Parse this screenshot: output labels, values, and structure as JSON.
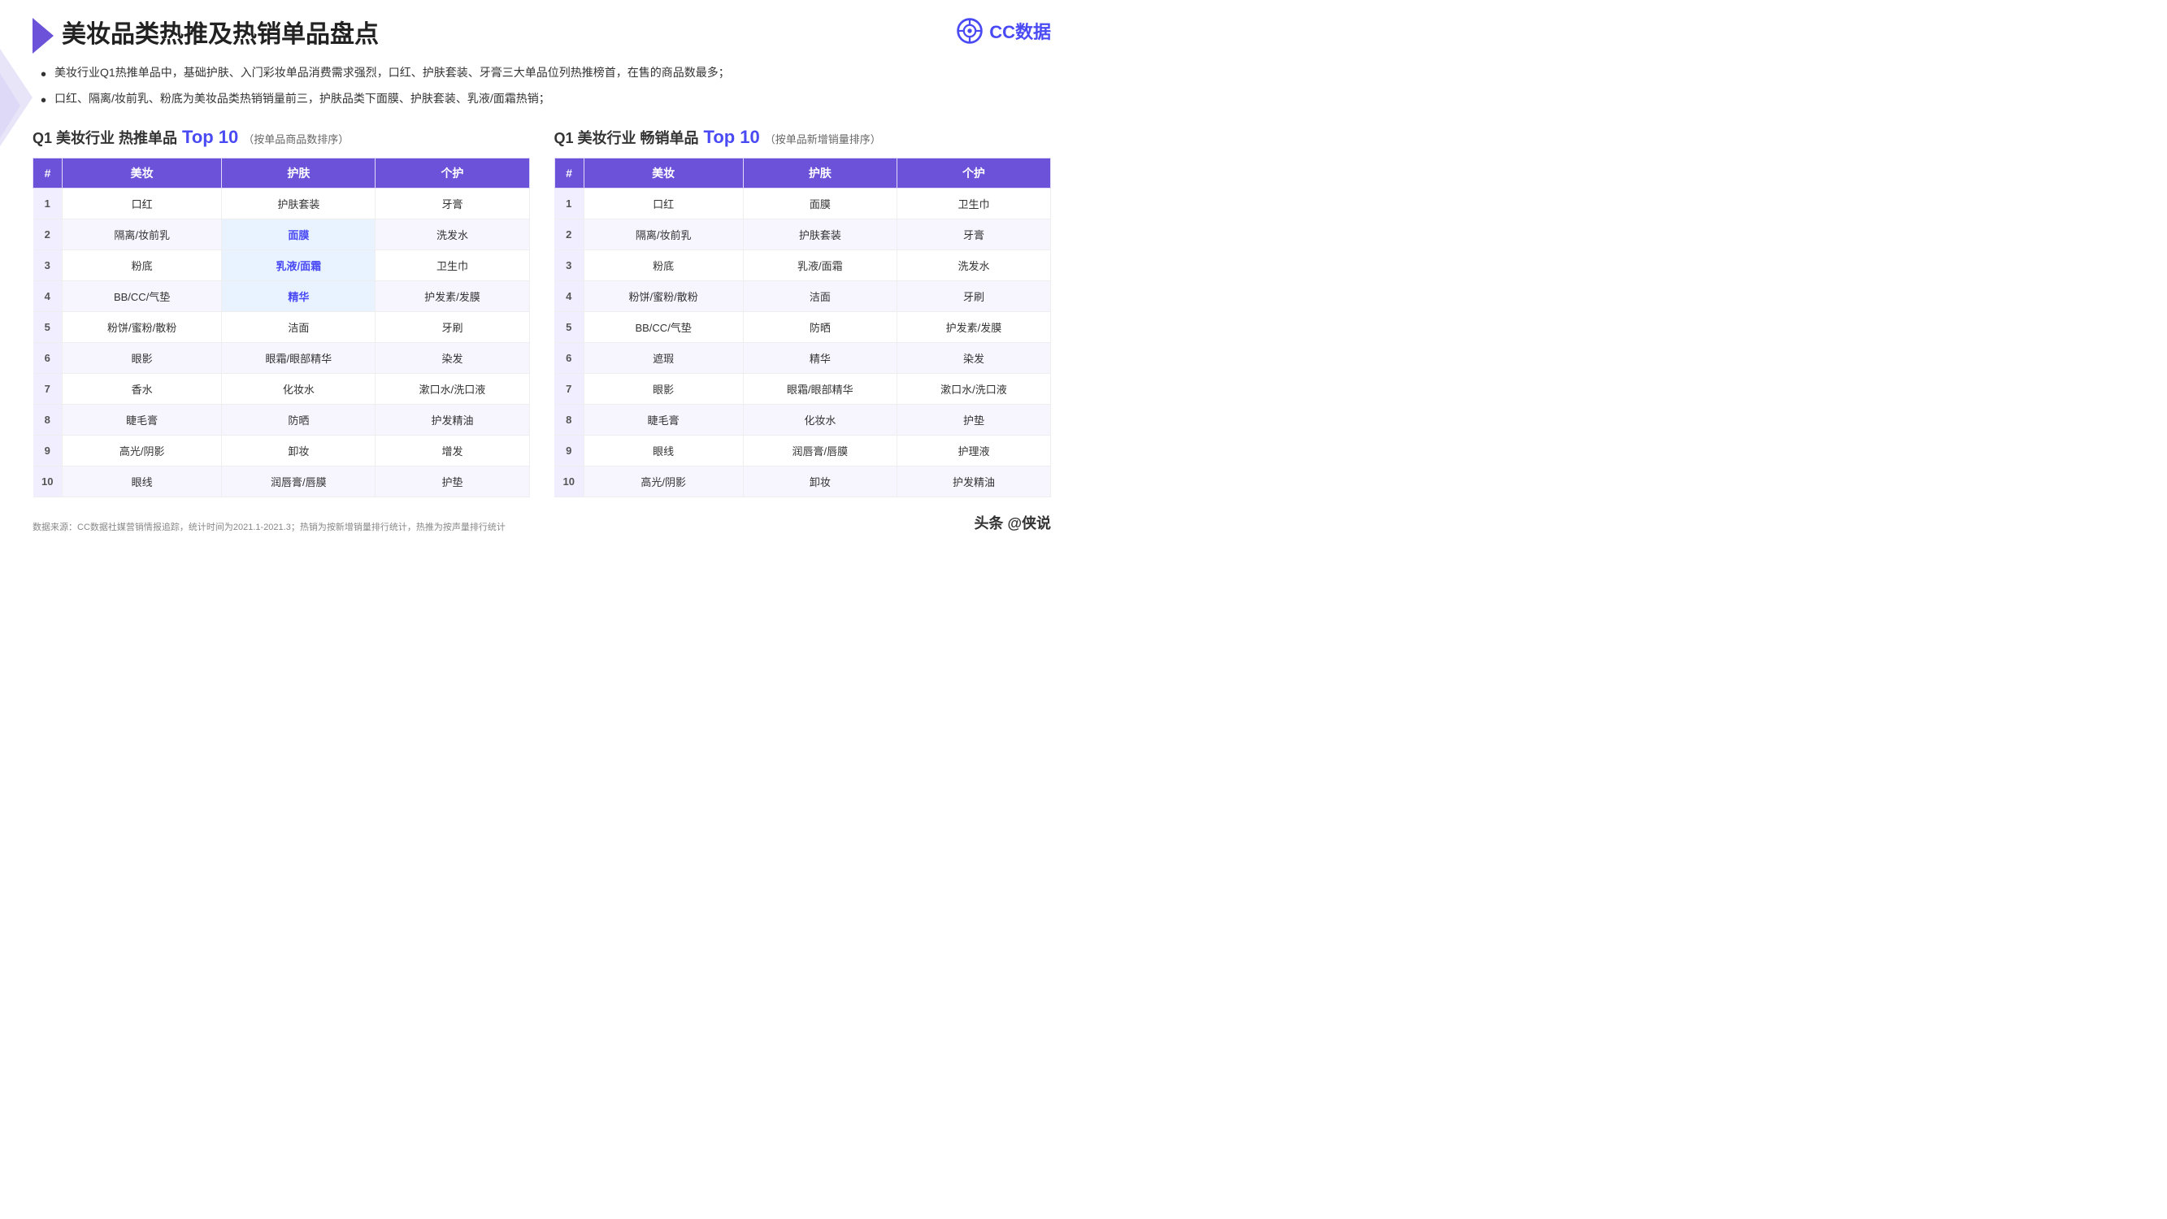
{
  "logo": {
    "text": "CC数据",
    "icon_label": "cc-logo-icon"
  },
  "page_title": "美妆品类热推及热销单品盘点",
  "bullets": [
    "美妆行业Q1热推单品中，基础护肤、入门彩妆单品消费需求强烈，口红、护肤套装、牙膏三大单品位列热推榜首，在售的商品数最多；",
    "口红、隔离/妆前乳、粉底为美妆品类热销销量前三，护肤品类下面膜、护肤套装、乳液/面霜热销；"
  ],
  "table1": {
    "title_prefix": "Q1 美妆行业 热推单品",
    "title_highlight": "Top",
    "title_number": "10",
    "title_suffix": "（按单品商品数排序）",
    "headers": [
      "#",
      "美妆",
      "护肤",
      "个护"
    ],
    "rows": [
      {
        "rank": "1",
        "col1": "口红",
        "col2": "护肤套装",
        "col3": "牙膏",
        "highlight": []
      },
      {
        "rank": "2",
        "col1": "隔离/妆前乳",
        "col2": "面膜",
        "col3": "洗发水",
        "highlight": [
          "col2"
        ]
      },
      {
        "rank": "3",
        "col1": "粉底",
        "col2": "乳液/面霜",
        "col3": "卫生巾",
        "highlight": [
          "col2"
        ]
      },
      {
        "rank": "4",
        "col1": "BB/CC/气垫",
        "col2": "精华",
        "col3": "护发素/发膜",
        "highlight": [
          "col2"
        ]
      },
      {
        "rank": "5",
        "col1": "粉饼/蜜粉/散粉",
        "col2": "洁面",
        "col3": "牙刷",
        "highlight": []
      },
      {
        "rank": "6",
        "col1": "眼影",
        "col2": "眼霜/眼部精华",
        "col3": "染发",
        "highlight": []
      },
      {
        "rank": "7",
        "col1": "香水",
        "col2": "化妆水",
        "col3": "漱口水/洗口液",
        "highlight": []
      },
      {
        "rank": "8",
        "col1": "睫毛膏",
        "col2": "防晒",
        "col3": "护发精油",
        "highlight": []
      },
      {
        "rank": "9",
        "col1": "高光/阴影",
        "col2": "卸妆",
        "col3": "增发",
        "highlight": []
      },
      {
        "rank": "10",
        "col1": "眼线",
        "col2": "润唇膏/唇膜",
        "col3": "护垫",
        "highlight": []
      }
    ]
  },
  "table2": {
    "title_prefix": "Q1 美妆行业 畅销单品",
    "title_highlight": "Top",
    "title_number": "10",
    "title_suffix": "（按单品新增销量排序）",
    "headers": [
      "#",
      "美妆",
      "护肤",
      "个护"
    ],
    "rows": [
      {
        "rank": "1",
        "col1": "口红",
        "col2": "面膜",
        "col3": "卫生巾",
        "highlight": []
      },
      {
        "rank": "2",
        "col1": "隔离/妆前乳",
        "col2": "护肤套装",
        "col3": "牙膏",
        "highlight": []
      },
      {
        "rank": "3",
        "col1": "粉底",
        "col2": "乳液/面霜",
        "col3": "洗发水",
        "highlight": []
      },
      {
        "rank": "4",
        "col1": "粉饼/蜜粉/散粉",
        "col2": "洁面",
        "col3": "牙刷",
        "highlight": []
      },
      {
        "rank": "5",
        "col1": "BB/CC/气垫",
        "col2": "防晒",
        "col3": "护发素/发膜",
        "highlight": []
      },
      {
        "rank": "6",
        "col1": "遮瑕",
        "col2": "精华",
        "col3": "染发",
        "highlight": []
      },
      {
        "rank": "7",
        "col1": "眼影",
        "col2": "眼霜/眼部精华",
        "col3": "漱口水/洗口液",
        "highlight": []
      },
      {
        "rank": "8",
        "col1": "睫毛膏",
        "col2": "化妆水",
        "col3": "护垫",
        "highlight": []
      },
      {
        "rank": "9",
        "col1": "眼线",
        "col2": "润唇膏/唇膜",
        "col3": "护理液",
        "highlight": []
      },
      {
        "rank": "10",
        "col1": "高光/阴影",
        "col2": "卸妆",
        "col3": "护发精油",
        "highlight": []
      }
    ]
  },
  "footer_note": "数据来源：CC数据社媒营销情报追踪，统计时间为2021.1-2021.3；热销为按新增销量排行统计，热推为按声量排行统计",
  "footer_brand": "头条 @侠说",
  "watermark_text": "CC数据"
}
